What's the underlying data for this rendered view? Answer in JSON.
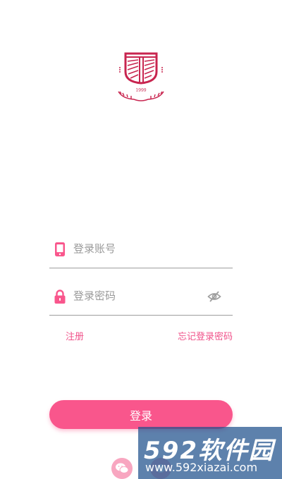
{
  "logo": {
    "year": "1999",
    "icon": "pocket-crest-logo"
  },
  "form": {
    "phone": {
      "icon": "phone-icon",
      "placeholder": "登录账号",
      "value": ""
    },
    "password": {
      "icon": "lock-icon",
      "placeholder": "登录密码",
      "value": "",
      "toggle_icon": "eye-off-icon"
    }
  },
  "links": {
    "register": "注册",
    "forgot": "忘记登录密码"
  },
  "login_button": "登录",
  "social": {
    "wechat_icon": "wechat-icon",
    "other_icon": "social-login-icon"
  },
  "watermark": {
    "brand": "592软件园",
    "url": "www.592xiazai.com"
  },
  "colors": {
    "accent": "#f9568c",
    "logo": "#c8254f",
    "link": "#f0528a",
    "divider": "#9e9e9e",
    "placeholder": "#9a9a9a"
  }
}
